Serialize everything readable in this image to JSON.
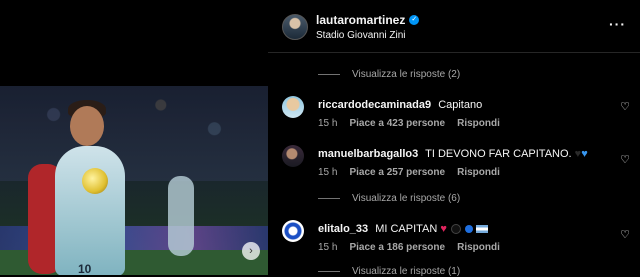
{
  "media": {
    "shirt_number": "10",
    "next_icon": "chevron-right-icon"
  },
  "post": {
    "author": {
      "username": "lautaromartinez",
      "location": "Stadio Giovanni Zini"
    },
    "more_icon": "more-options-icon"
  },
  "replies_links": [
    {
      "label": "Visualizza le risposte (2)"
    },
    {
      "label": "Visualizza le risposte (6)"
    },
    {
      "label": "Visualizza le risposte (1)"
    }
  ],
  "comments": [
    {
      "username": "riccardodecaminada9",
      "text": "Capitano",
      "time": "15 h",
      "likes": "Piace a 423 persone",
      "reply": "Rispondi"
    },
    {
      "username": "manuelbarbagallo3",
      "text": "TI DEVONO FAR CAPITANO.",
      "emoji_hearts": [
        "#1a1a1a",
        "#3897f0"
      ],
      "time": "15 h",
      "likes": "Piace a 257 persone",
      "reply": "Rispondi"
    },
    {
      "username": "elitalo_33",
      "text": "MI CAPITAN",
      "emoji_tail": [
        "heart-red",
        "circle-black",
        "circle-blue",
        "flag-argentina"
      ],
      "time": "15 h",
      "likes": "Piace a 186 persone",
      "reply": "Rispondi"
    }
  ],
  "colors": {
    "background": "#000000",
    "secondary_text": "#a8a8a8",
    "verified_blue": "#0095f6"
  }
}
